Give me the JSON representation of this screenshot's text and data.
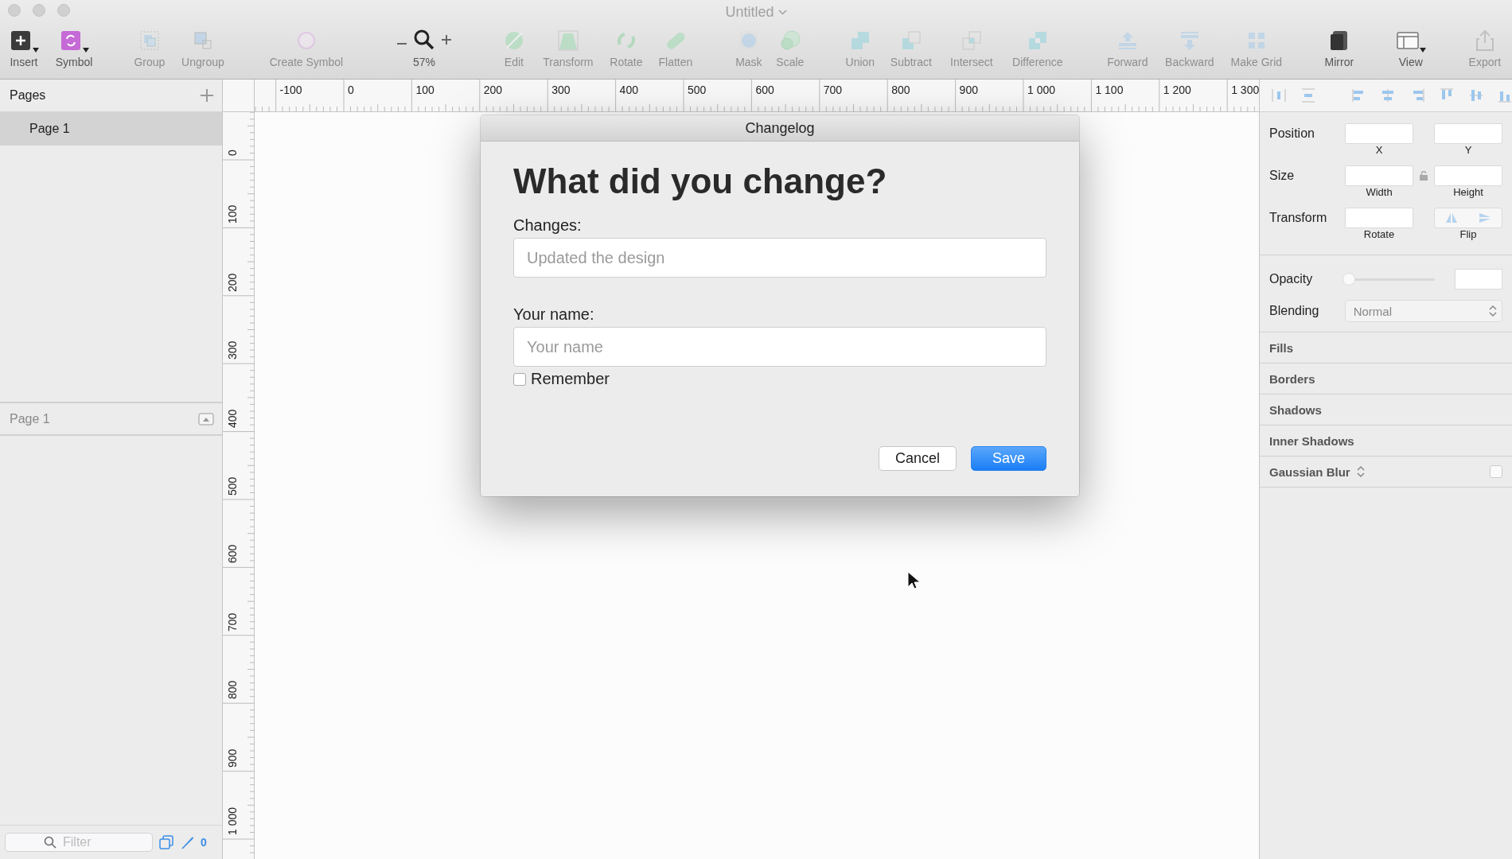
{
  "window": {
    "title": "Untitled"
  },
  "toolbar": [
    {
      "kind": "tool",
      "label": "Insert",
      "disabled": false,
      "has_menu": true
    },
    {
      "kind": "tool",
      "label": "Symbol",
      "disabled": false,
      "has_menu": true
    },
    {
      "kind": "tool",
      "label": "Group",
      "disabled": true,
      "has_menu": false
    },
    {
      "kind": "tool",
      "label": "Ungroup",
      "disabled": true,
      "has_menu": false
    },
    {
      "kind": "tool",
      "label": "Create Symbol",
      "disabled": true,
      "has_menu": false
    },
    {
      "kind": "zoom",
      "label": "57%",
      "disabled": false
    },
    {
      "kind": "tool",
      "label": "Edit",
      "disabled": true,
      "has_menu": false
    },
    {
      "kind": "tool",
      "label": "Transform",
      "disabled": true,
      "has_menu": false
    },
    {
      "kind": "tool",
      "label": "Rotate",
      "disabled": true,
      "has_menu": false
    },
    {
      "kind": "tool",
      "label": "Flatten",
      "disabled": true,
      "has_menu": false
    },
    {
      "kind": "tool",
      "label": "Mask",
      "disabled": true,
      "has_menu": false
    },
    {
      "kind": "tool",
      "label": "Scale",
      "disabled": true,
      "has_menu": false
    },
    {
      "kind": "tool",
      "label": "Union",
      "disabled": true,
      "has_menu": false
    },
    {
      "kind": "tool",
      "label": "Subtract",
      "disabled": true,
      "has_menu": false
    },
    {
      "kind": "tool",
      "label": "Intersect",
      "disabled": true,
      "has_menu": false
    },
    {
      "kind": "tool",
      "label": "Difference",
      "disabled": true,
      "has_menu": false
    },
    {
      "kind": "tool",
      "label": "Forward",
      "disabled": true,
      "has_menu": false
    },
    {
      "kind": "tool",
      "label": "Backward",
      "disabled": true,
      "has_menu": false
    },
    {
      "kind": "tool",
      "label": "Make Grid",
      "disabled": true,
      "has_menu": false
    },
    {
      "kind": "tool",
      "label": "Mirror",
      "disabled": false,
      "has_menu": false
    },
    {
      "kind": "tool",
      "label": "View",
      "disabled": false,
      "has_menu": true
    },
    {
      "kind": "tool",
      "label": "Export",
      "disabled": true,
      "has_menu": false
    }
  ],
  "sidebar": {
    "title": "Pages",
    "pages": [
      {
        "label": "Page 1",
        "selected": true
      }
    ],
    "layers_header": "Page 1",
    "filter": {
      "placeholder": "Filter"
    },
    "count": "0"
  },
  "rulers": {
    "horizontal": [
      "-100",
      "0",
      "100",
      "200",
      "300",
      "400",
      "500",
      "600",
      "700",
      "800",
      "900",
      "1 000",
      "1 100",
      "1 200",
      "1 300"
    ],
    "vertical": [
      "0",
      "100",
      "200",
      "300",
      "400",
      "500",
      "600",
      "700",
      "800",
      "900",
      "1 000"
    ]
  },
  "inspector": {
    "position": {
      "label": "Position",
      "x_caption": "X",
      "y_caption": "Y"
    },
    "size": {
      "label": "Size",
      "width_caption": "Width",
      "height_caption": "Height"
    },
    "transform": {
      "label": "Transform",
      "rotate_caption": "Rotate",
      "flip_caption": "Flip"
    },
    "opacity": {
      "label": "Opacity",
      "level": 0
    },
    "blending": {
      "label": "Blending",
      "value": "Normal"
    },
    "sections": [
      "Fills",
      "Borders",
      "Shadows",
      "Inner Shadows"
    ],
    "blur": {
      "label": "Gaussian Blur",
      "checked": false
    }
  },
  "dialog": {
    "title": "Changelog",
    "heading": "What did you change?",
    "fields": [
      {
        "label": "Changes:",
        "placeholder": "Updated the design"
      },
      {
        "label": "Your name:",
        "placeholder": "Your name"
      }
    ],
    "remember": {
      "label": "Remember",
      "checked": false
    },
    "buttons": [
      {
        "label": "Cancel",
        "primary": false
      },
      {
        "label": "Save",
        "primary": true
      }
    ]
  }
}
